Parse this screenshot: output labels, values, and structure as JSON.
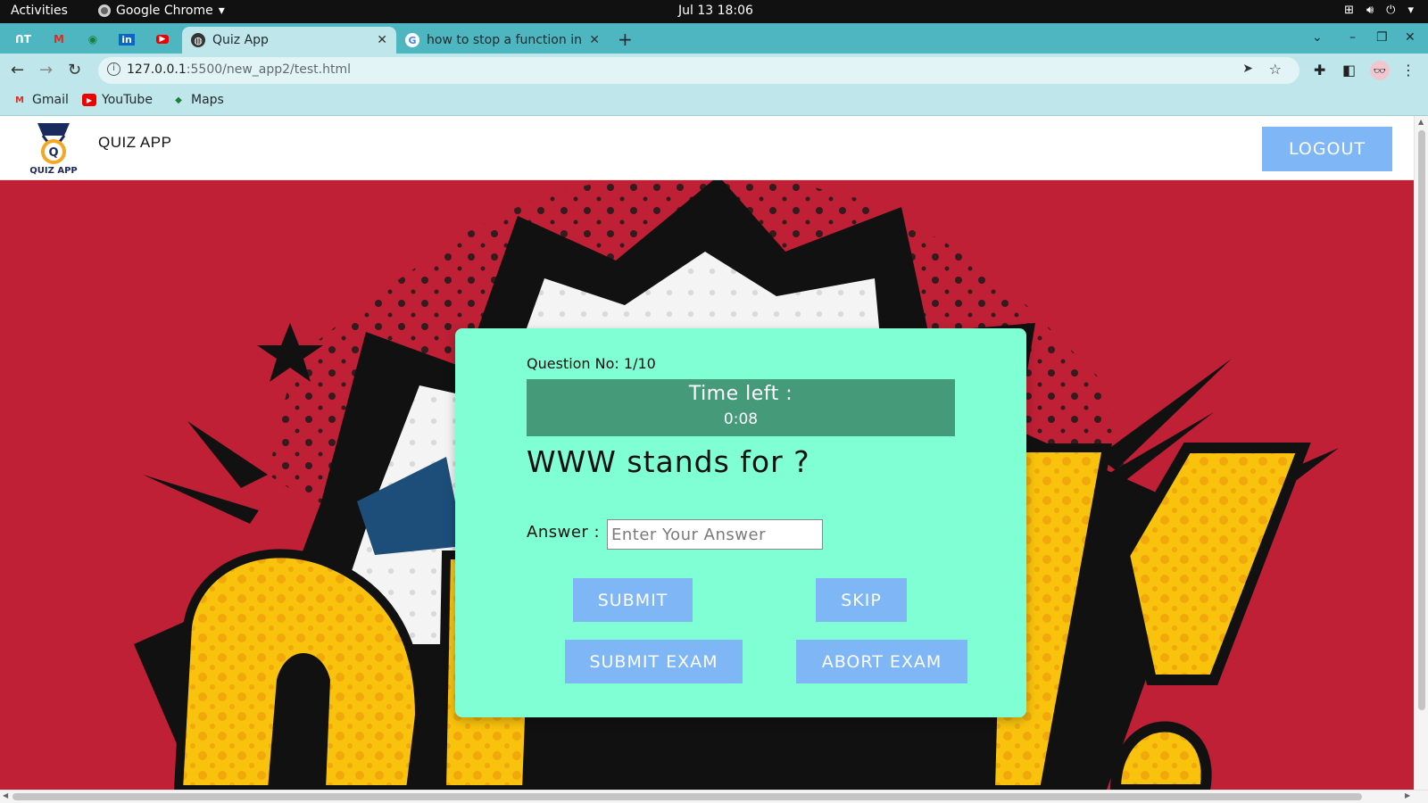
{
  "os": {
    "activities": "Activities",
    "app_name": "Google Chrome",
    "clock": "Jul 13  18:06"
  },
  "browser": {
    "tabs": [
      {
        "title": "Quiz App",
        "active": true,
        "icon": "globe-icon"
      },
      {
        "title": "how to stop a function in",
        "active": false,
        "icon": "google-icon"
      }
    ],
    "pinned_tabs": [
      "notion-icon",
      "gmail-icon",
      "maps-icon",
      "linkedin-icon",
      "youtube-icon"
    ],
    "url_host": "127.0.0.1",
    "url_path": ":5500/new_app2/test.html",
    "bookmarks": [
      {
        "label": "Gmail",
        "icon": "gmail-icon"
      },
      {
        "label": "YouTube",
        "icon": "youtube-icon"
      },
      {
        "label": "Maps",
        "icon": "maps-icon"
      }
    ]
  },
  "app": {
    "logo_text": "QUIZ APP",
    "title": "QUIZ APP",
    "logout_label": "LOGOUT"
  },
  "quiz": {
    "question_number": "Question No: 1/10",
    "time_left_label": "Time left :",
    "time_left_value": "0:08",
    "question": "WWW stands for ?",
    "answer_label": "Answer :",
    "answer_placeholder": "Enter Your Answer",
    "submit_label": "SUBMIT",
    "skip_label": "SKIP",
    "submit_exam_label": "SUBMIT EXAM",
    "abort_exam_label": "ABORT EXAM"
  },
  "colors": {
    "hero_background": "#bf2035",
    "card_background": "#80ffd4",
    "timer_background": "#459b79",
    "button_blue": "#7fb7f6",
    "tab_strip": "#4db6c0",
    "toolbar": "#bfe6ea"
  }
}
